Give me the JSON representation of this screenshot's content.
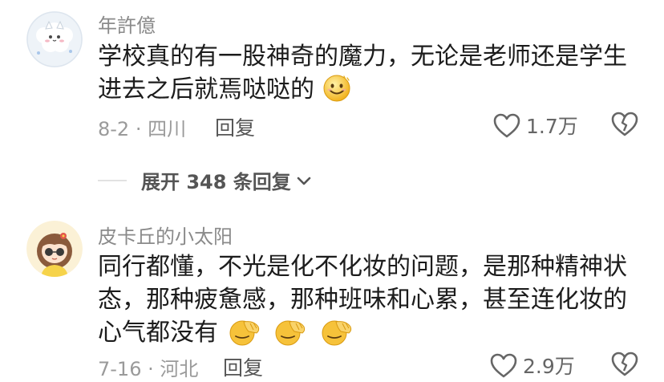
{
  "comments": [
    {
      "username": "年許億",
      "content_line1": "学校真的有一股神奇的魔力，无论是老师还是学生",
      "content_line2": "进去之后就焉哒哒的",
      "date": "8-2",
      "location": "四川",
      "date_location": "8-2 · 四川",
      "reply_label": "回复",
      "likes": "1.7万",
      "emoji_icons": [
        "slightly-smiling-face-icon"
      ]
    },
    {
      "username": "皮卡丘的小太阳",
      "content_line1": "同行都懂，不光是化不化妆的问题，是那种精神状",
      "content_line2": "态，那种疲惫感，那种班味和心累，甚至连化妆的",
      "content_line3": "心气都没有",
      "date": "7-16",
      "location": "河北",
      "date_location": "7-16 · 河北",
      "reply_label": "回复",
      "likes": "2.9万",
      "emoji_icons": [
        "facepalm-icon",
        "facepalm-icon",
        "facepalm-icon"
      ]
    }
  ],
  "expand_replies": {
    "label": "展开 348 条回复"
  },
  "colors": {
    "username": "#8a8a8a",
    "content": "#1c1c1c",
    "meta": "#9a9a9a",
    "emoji_yellow": "#f6c23a"
  }
}
